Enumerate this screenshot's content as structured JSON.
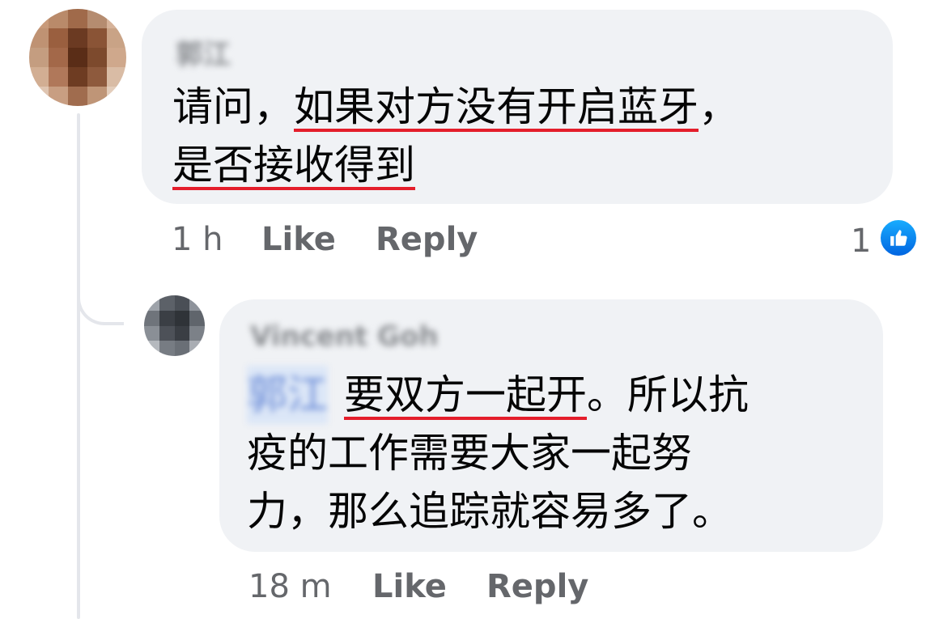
{
  "comment": {
    "author": "郭江",
    "text_lines": [
      {
        "plain": "请问，",
        "underlined": "如果对方没有开启蓝牙",
        "tail": "，"
      },
      {
        "plain": "",
        "underlined": "是否接收得到",
        "tail": ""
      }
    ],
    "time": "1 h",
    "like_label": "Like",
    "reply_label": "Reply",
    "reaction_count": "1",
    "reaction_icon": "thumbs-up-icon"
  },
  "reply": {
    "author": "Vincent Goh",
    "mention": "郭江",
    "text_lines": [
      {
        "underlined": "要双方一起开",
        "tail": "。所以抗"
      },
      {
        "plain": "疫的工作需要大家一起努"
      },
      {
        "plain": "力，那么追踪就容易多了。"
      }
    ],
    "time": "18 m",
    "like_label": "Like",
    "reply_label": "Reply"
  },
  "colors": {
    "bubble": "#f0f2f5",
    "meta_text": "#65676b",
    "underline": "#e41e2b",
    "like_blue": "#0866ff",
    "thread_line": "#e4e6eb"
  }
}
